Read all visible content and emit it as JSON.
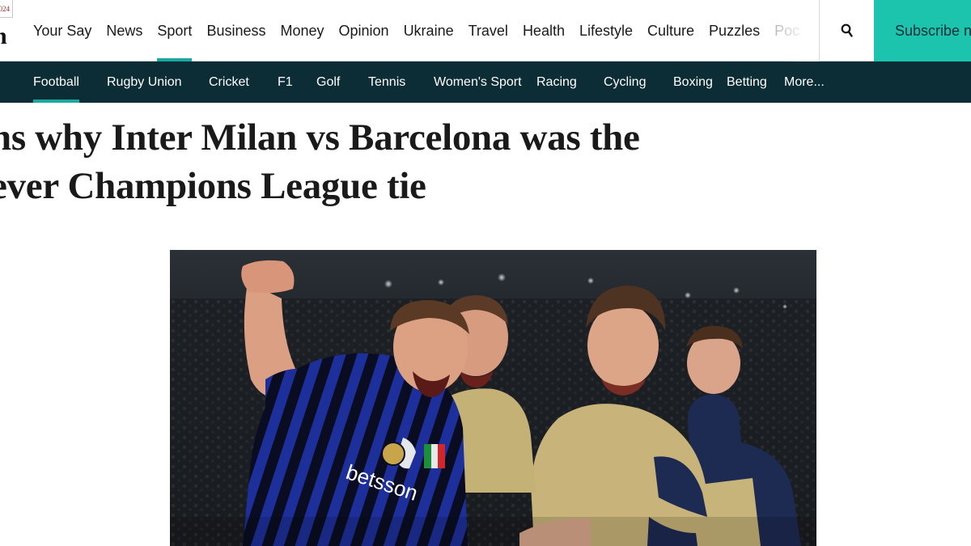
{
  "masthead": {
    "badge_text": "024",
    "logo_fragment": "h"
  },
  "topnav": {
    "items": [
      {
        "label": "Your Say"
      },
      {
        "label": "News"
      },
      {
        "label": "Sport"
      },
      {
        "label": "Business"
      },
      {
        "label": "Money"
      },
      {
        "label": "Opinion"
      },
      {
        "label": "Ukraine"
      },
      {
        "label": "Travel"
      },
      {
        "label": "Health"
      },
      {
        "label": "Lifestyle"
      },
      {
        "label": "Culture"
      },
      {
        "label": "Puzzles"
      },
      {
        "label": "Poc"
      }
    ],
    "active_item": "Sport",
    "search_icon": "search-icon",
    "subscribe_label": "Subscribe n"
  },
  "subnav": {
    "items": [
      {
        "label": "Football"
      },
      {
        "label": "Rugby Union"
      },
      {
        "label": "Cricket"
      },
      {
        "label": "F1"
      },
      {
        "label": "Golf"
      },
      {
        "label": "Tennis"
      },
      {
        "label": "Women's Sport"
      },
      {
        "label": "Racing"
      },
      {
        "label": "Cycling"
      },
      {
        "label": "Boxing"
      },
      {
        "label": "Betting"
      },
      {
        "label": "More..."
      }
    ],
    "active_item": "Football"
  },
  "article": {
    "headline_line_1": "ns why Inter Milan vs Barcelona was the",
    "headline_line_2": "ever Champions League tie",
    "hero_image": "celebrating footballers photo",
    "hero_shirt_text": "betsson"
  },
  "colors": {
    "accent": "#1aa8a0",
    "subscribe": "#1cc4ae",
    "subnav_bg": "#0c2c36"
  }
}
